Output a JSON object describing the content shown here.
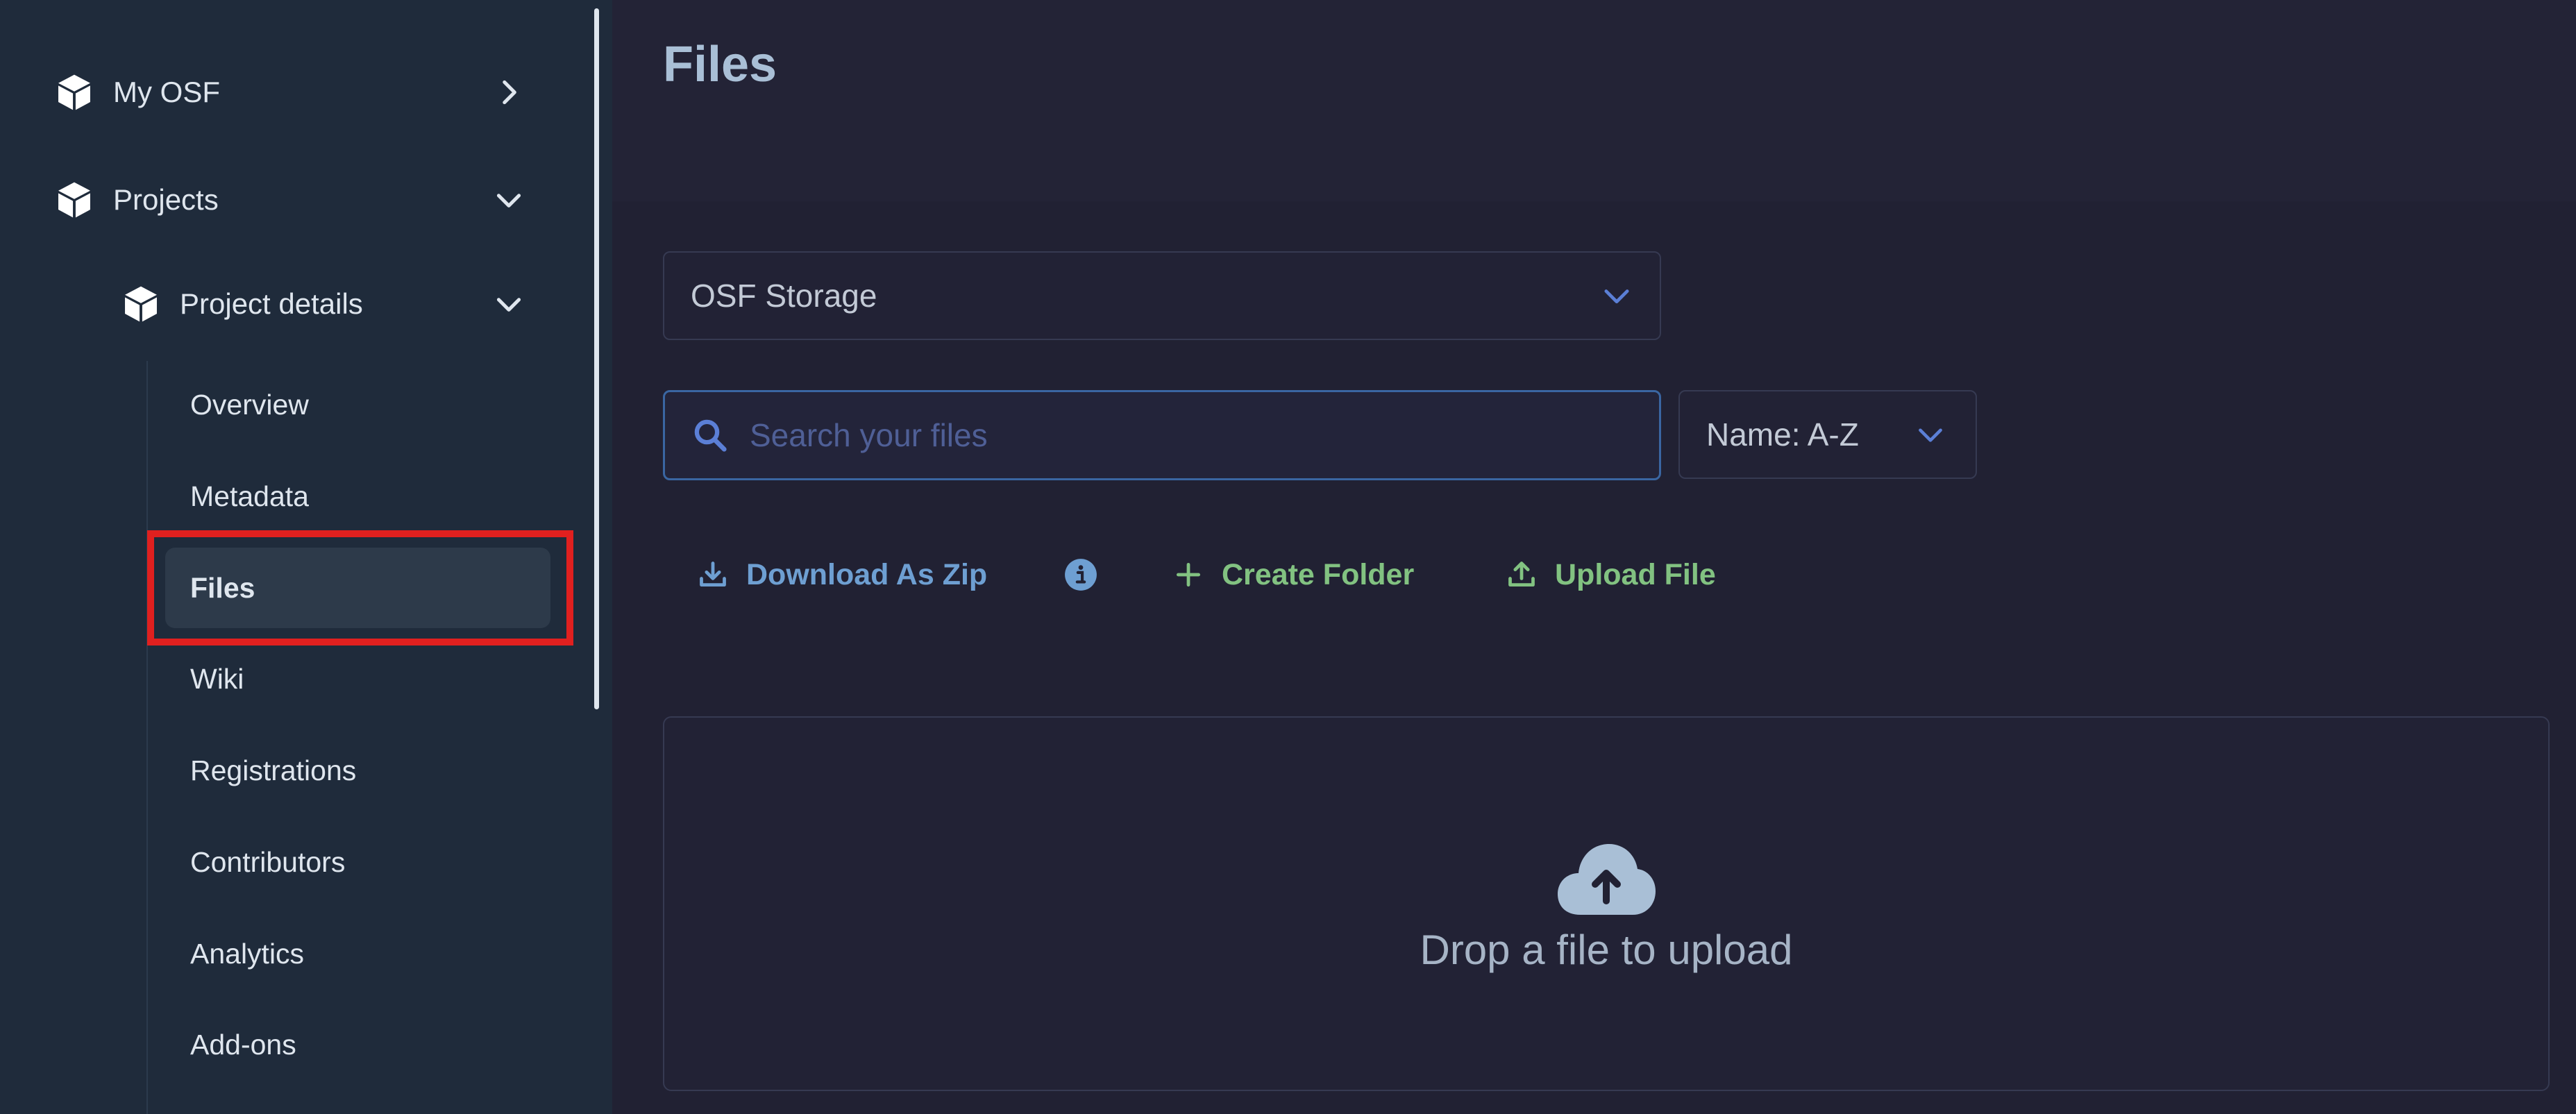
{
  "sidebar": {
    "top_items": [
      {
        "label": "My OSF",
        "icon": "cube-icon",
        "chevron": "chevron-right-icon"
      },
      {
        "label": "Projects",
        "icon": "cube-icon",
        "chevron": "chevron-down-icon"
      }
    ],
    "project_details": {
      "label": "Project details",
      "icon": "cube-icon",
      "chevron": "chevron-down-icon"
    },
    "sub_items": [
      "Overview",
      "Metadata",
      "Files",
      "Wiki",
      "Registrations",
      "Contributors",
      "Analytics",
      "Add-ons"
    ],
    "active_item": "Files",
    "highlight_color": "#e0201f"
  },
  "main": {
    "title": "Files",
    "storage_select": {
      "value": "OSF Storage"
    },
    "search": {
      "placeholder": "Search your files",
      "value": ""
    },
    "sort_select": {
      "value": "Name: A-Z"
    },
    "actions": {
      "download_zip": "Download As Zip",
      "create_folder": "Create Folder",
      "upload_file": "Upload File"
    },
    "dropzone": {
      "text": "Drop a file to upload"
    }
  },
  "colors": {
    "sidebar_bg": "#1f2b3b",
    "main_bg": "#212133",
    "accent_blue": "#6e9fd2",
    "accent_green": "#82c281",
    "chevron_blue": "#5b7fd6"
  }
}
